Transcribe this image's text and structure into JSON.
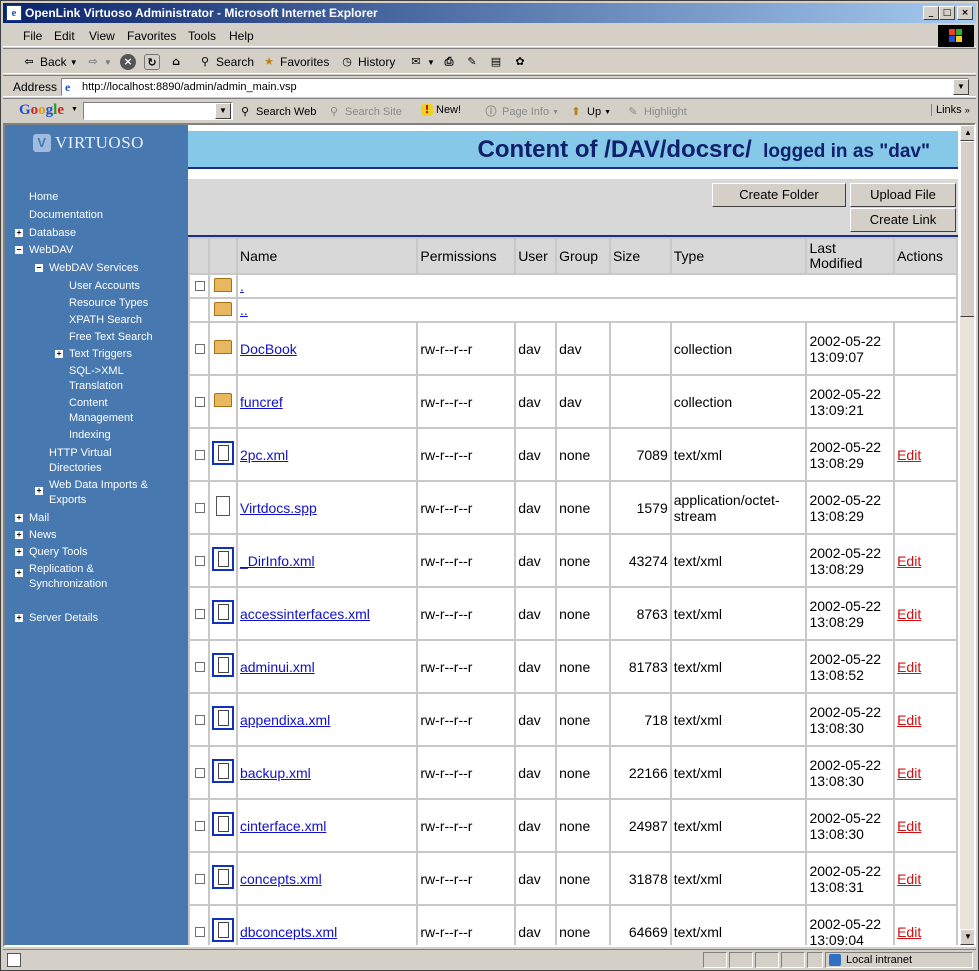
{
  "window": {
    "title": "OpenLink Virtuoso Administrator - Microsoft Internet Explorer",
    "controls": [
      "_",
      "□",
      "×"
    ]
  },
  "menu": [
    "File",
    "Edit",
    "View",
    "Favorites",
    "Tools",
    "Help"
  ],
  "toolbar": {
    "back": "Back",
    "search": "Search",
    "favorites": "Favorites",
    "history": "History"
  },
  "address": {
    "label": "Address",
    "url": "http://localhost:8890/admin/admin_main.vsp"
  },
  "googlebar": {
    "logo": "Google",
    "search_web": "Search Web",
    "search_site": "Search Site",
    "new": "New!",
    "page_info": "Page Info",
    "up": "Up",
    "highlight": "Highlight",
    "links": "Links"
  },
  "sidebar": {
    "logo": "VIRTUOSO",
    "items": {
      "home": "Home",
      "documentation": "Documentation",
      "database": "Database",
      "webdav": "WebDAV",
      "webdav_services": "WebDAV Services",
      "user_accounts": "User Accounts",
      "resource_types": "Resource Types",
      "xpath_search": "XPATH Search",
      "free_text_search": "Free Text Search",
      "text_triggers": "Text Triggers",
      "sql_xml": "SQL->XML",
      "translation": "Translation",
      "content": "Content",
      "management": "Management",
      "indexing": "Indexing",
      "http_virtual": "HTTP Virtual",
      "directories": "Directories",
      "web_data_imports": "Web Data Imports &",
      "exports": "Exports",
      "mail": "Mail",
      "news": "News",
      "query_tools": "Query Tools",
      "replication": "Replication &",
      "synchronization": "Synchronization",
      "server_details": "Server Details"
    }
  },
  "main": {
    "heading": "Content of /DAV/docsrc/",
    "logged_in": "logged in as \"dav\"",
    "buttons": {
      "create_folder": "Create Folder",
      "upload_file": "Upload File",
      "create_link": "Create Link"
    },
    "columns": {
      "name": "Name",
      "permissions": "Permissions",
      "user": "User",
      "group": "Group",
      "size": "Size",
      "type": "Type",
      "last_modified": "Last Modified",
      "actions": "Actions"
    },
    "rows": [
      {
        "name": ".",
        "kind": "folder",
        "checkbox": true
      },
      {
        "name": "..",
        "kind": "folder",
        "checkbox": false
      },
      {
        "name": "DocBook",
        "kind": "folder",
        "checkbox": true,
        "permissions": "rw-r--r--r",
        "user": "dav",
        "group": "dav",
        "size": "",
        "type": "collection",
        "modified": "2002-05-22 13:09:07",
        "action": ""
      },
      {
        "name": "funcref",
        "kind": "folder",
        "checkbox": true,
        "permissions": "rw-r--r--r",
        "user": "dav",
        "group": "dav",
        "size": "",
        "type": "collection",
        "modified": "2002-05-22 13:09:21",
        "action": ""
      },
      {
        "name": "2pc.xml",
        "kind": "xml",
        "checkbox": true,
        "permissions": "rw-r--r--r",
        "user": "dav",
        "group": "none",
        "size": "7089",
        "type": "text/xml",
        "modified": "2002-05-22 13:08:29",
        "action": "Edit"
      },
      {
        "name": "Virtdocs.spp",
        "kind": "file",
        "checkbox": true,
        "permissions": "rw-r--r--r",
        "user": "dav",
        "group": "none",
        "size": "1579",
        "type": "application/octet-stream",
        "modified": "2002-05-22 13:08:29",
        "action": ""
      },
      {
        "name": "_DirInfo.xml",
        "kind": "xml",
        "checkbox": true,
        "permissions": "rw-r--r--r",
        "user": "dav",
        "group": "none",
        "size": "43274",
        "type": "text/xml",
        "modified": "2002-05-22 13:08:29",
        "action": "Edit"
      },
      {
        "name": "accessinterfaces.xml",
        "kind": "xml",
        "checkbox": true,
        "permissions": "rw-r--r--r",
        "user": "dav",
        "group": "none",
        "size": "8763",
        "type": "text/xml",
        "modified": "2002-05-22 13:08:29",
        "action": "Edit"
      },
      {
        "name": "adminui.xml",
        "kind": "xml",
        "checkbox": true,
        "permissions": "rw-r--r--r",
        "user": "dav",
        "group": "none",
        "size": "81783",
        "type": "text/xml",
        "modified": "2002-05-22 13:08:52",
        "action": "Edit"
      },
      {
        "name": "appendixa.xml",
        "kind": "xml",
        "checkbox": true,
        "permissions": "rw-r--r--r",
        "user": "dav",
        "group": "none",
        "size": "718",
        "type": "text/xml",
        "modified": "2002-05-22 13:08:30",
        "action": "Edit"
      },
      {
        "name": "backup.xml",
        "kind": "xml",
        "checkbox": true,
        "permissions": "rw-r--r--r",
        "user": "dav",
        "group": "none",
        "size": "22166",
        "type": "text/xml",
        "modified": "2002-05-22 13:08:30",
        "action": "Edit"
      },
      {
        "name": "cinterface.xml",
        "kind": "xml",
        "checkbox": true,
        "permissions": "rw-r--r--r",
        "user": "dav",
        "group": "none",
        "size": "24987",
        "type": "text/xml",
        "modified": "2002-05-22 13:08:30",
        "action": "Edit"
      },
      {
        "name": "concepts.xml",
        "kind": "xml",
        "checkbox": true,
        "permissions": "rw-r--r--r",
        "user": "dav",
        "group": "none",
        "size": "31878",
        "type": "text/xml",
        "modified": "2002-05-22 13:08:31",
        "action": "Edit"
      },
      {
        "name": "dbconcepts.xml",
        "kind": "xml",
        "checkbox": true,
        "permissions": "rw-r--r--r",
        "user": "dav",
        "group": "none",
        "size": "64669",
        "type": "text/xml",
        "modified": "2002-05-22 13:09:04",
        "action": "Edit"
      }
    ]
  },
  "status": {
    "zone": "Local intranet"
  },
  "colors": {
    "sidebar": "#4778b0",
    "heading_bg": "#86c8e8",
    "heading_text": "#10206c",
    "link": "#1010c8",
    "edit_link": "#d01010"
  }
}
